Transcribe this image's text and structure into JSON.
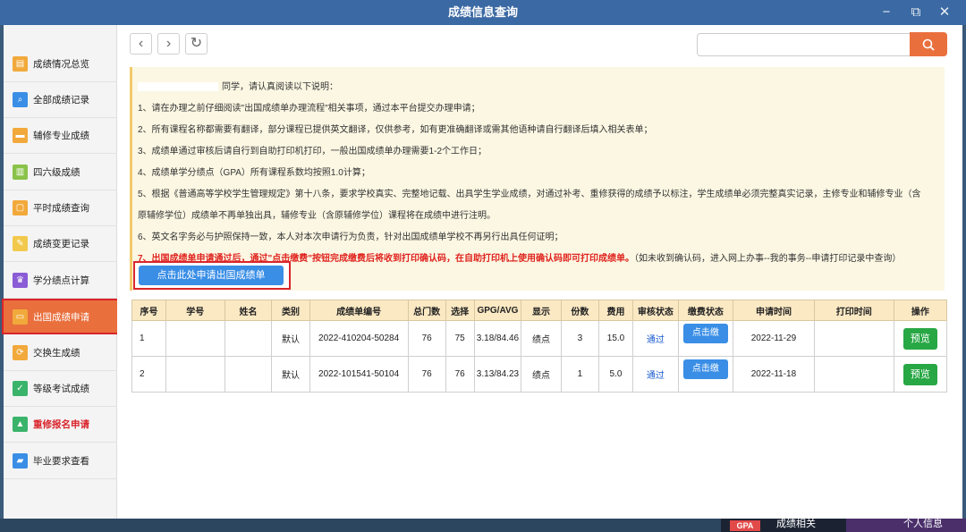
{
  "window": {
    "title": "成绩信息查询",
    "min_icon": "−",
    "max_icon": "⧉",
    "close_icon": "✕"
  },
  "sidebar": {
    "items": [
      {
        "label": "成绩情况总览",
        "icon": "overview-icon",
        "color": "#f2a93b"
      },
      {
        "label": "全部成绩记录",
        "icon": "search-record-icon",
        "color": "#3a8ee6"
      },
      {
        "label": "辅修专业成绩",
        "icon": "minor-icon",
        "color": "#f2a93b"
      },
      {
        "label": "四六级成绩",
        "icon": "cet-icon",
        "color": "#8bc34a"
      },
      {
        "label": "平时成绩查询",
        "icon": "daily-icon",
        "color": "#f2a93b"
      },
      {
        "label": "成绩变更记录",
        "icon": "edit-icon",
        "color": "#f2c94c"
      },
      {
        "label": "学分绩点计算",
        "icon": "gpa-icon",
        "color": "#8a5cd6"
      },
      {
        "label": "出国成绩申请",
        "icon": "abroad-icon",
        "color": "#f2a93b"
      },
      {
        "label": "交换生成绩",
        "icon": "exchange-icon",
        "color": "#f2a93b"
      },
      {
        "label": "等级考试成绩",
        "icon": "grade-exam-icon",
        "color": "#3ab36b"
      },
      {
        "label": "重修报名申请",
        "icon": "retake-icon",
        "color": "#3ab36b"
      },
      {
        "label": "毕业要求查看",
        "icon": "graduation-icon",
        "color": "#3a8ee6"
      }
    ],
    "active_index": 7
  },
  "toolbar": {
    "back": "‹",
    "forward": "›",
    "refresh": "↻",
    "search_value": ""
  },
  "notice": {
    "greeting": "同学，请认真阅读以下说明：",
    "lines": [
      "1、请在办理之前仔细阅读\"出国成绩单办理流程\"相关事项，通过本平台提交办理申请；",
      "2、所有课程名称都需要有翻译，部分课程已提供英文翻译，仅供参考，如有更准确翻译或需其他语种请自行翻译后填入相关表单；",
      "3、成绩单通过审核后请自行到自助打印机打印，一般出国成绩单办理需要1-2个工作日；",
      "4、成绩单学分绩点（GPA）所有课程系数均按照1.0计算；",
      "5、根据《普通高等学校学生管理规定》第十八条，要求学校真实、完整地记载、出具学生学业成绩，对通过补考、重修获得的成绩予以标注，学生成绩单必须完整真实记录，主修专业和辅修专业（含",
      "原辅修学位）成绩单不再单独出具，辅修专业（含原辅修学位）课程将在成绩中进行注明。",
      "6、英文名字务必与护照保持一致，本人对本次申请行为负责，针对出国成绩单学校不再另行出具任何证明；"
    ],
    "line7_red": "7、出国成绩单申请通过后，通过\"点击缴费\"按钮完成缴费后将收到打印确认码，在自助打印机上使用确认码即可打印成绩单。",
    "line7_gray": "（如未收到确认码，进入网上办事--我的事务--申请打印记录中查询）"
  },
  "apply_button": "点击此处申请出国成绩单",
  "table": {
    "headers": [
      "序号",
      "学号",
      "姓名",
      "类别",
      "成绩单编号",
      "总门数",
      "选择",
      "GPG/AVG",
      "显示",
      "份数",
      "费用",
      "审核状态",
      "缴费状态",
      "申请时间",
      "打印时间",
      "操作"
    ],
    "rows": [
      {
        "no": "1",
        "id": "",
        "name": "",
        "type": "默认",
        "code": "2022-410204-50284",
        "total": "76",
        "selected": "75",
        "gpa": "3.18/84.46",
        "display": "绩点",
        "copies": "3",
        "fee": "15.0",
        "audit": "通过",
        "pay": "点击缴",
        "applied": "2022-11-29",
        "printed": "",
        "action": "预览"
      },
      {
        "no": "2",
        "id": "",
        "name": "",
        "type": "默认",
        "code": "2022-101541-50104",
        "total": "76",
        "selected": "76",
        "gpa": "3.13/84.23",
        "display": "绩点",
        "copies": "1",
        "fee": "5.0",
        "audit": "通过",
        "pay": "点击缴",
        "applied": "2022-11-18",
        "printed": "",
        "action": "预览"
      }
    ]
  },
  "taskbar": {
    "gpa_badge": "GPA",
    "gpa_label": "成绩相关",
    "me_label": "个人信息"
  }
}
